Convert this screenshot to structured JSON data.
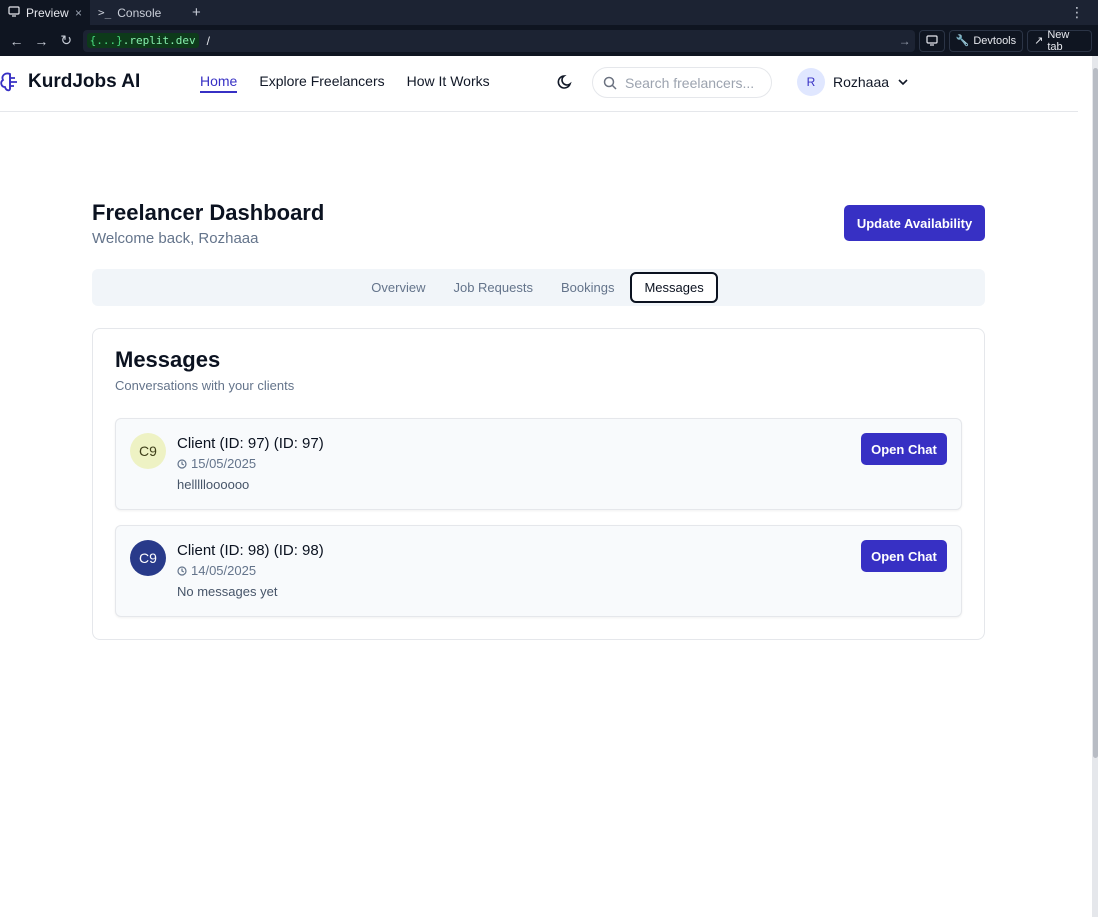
{
  "browser": {
    "tabs": [
      {
        "label": "Preview",
        "close": "×"
      },
      {
        "label": "Console"
      }
    ],
    "new_tab_symbol": "+",
    "url_host": "{...}",
    "url_domain": ".replit.dev",
    "url_path": "/",
    "devtools_label": "Devtools",
    "newtab_label": "New tab"
  },
  "header": {
    "brand": "KurdJobs AI",
    "nav": [
      {
        "label": "Home",
        "active": true
      },
      {
        "label": "Explore Freelancers"
      },
      {
        "label": "How It Works"
      }
    ],
    "search_placeholder": "Search freelancers...",
    "user_initial": "R",
    "user_name": "Rozhaaa"
  },
  "dashboard": {
    "title": "Freelancer Dashboard",
    "subtitle": "Welcome back, Rozhaaa",
    "update_button": "Update Availability",
    "tabs": [
      {
        "label": "Overview"
      },
      {
        "label": "Job Requests"
      },
      {
        "label": "Bookings"
      },
      {
        "label": "Messages",
        "active": true
      }
    ]
  },
  "messages": {
    "title": "Messages",
    "subtitle": "Conversations with your clients",
    "conversations": [
      {
        "initials": "C9",
        "name": "Client (ID: 97) (ID: 97)",
        "date": "15/05/2025",
        "preview": "hellllloooooo",
        "open_label": "Open Chat",
        "avatar_bg": "#eef2c4",
        "avatar_fg": "#3f3f1a"
      },
      {
        "initials": "C9",
        "name": "Client (ID: 98) (ID: 98)",
        "date": "14/05/2025",
        "preview": "No messages yet",
        "open_label": "Open Chat",
        "avatar_bg": "#283a8a",
        "avatar_fg": "#ffffff"
      }
    ]
  },
  "colors": {
    "primary": "#3730c4",
    "muted_text": "#64748b"
  }
}
